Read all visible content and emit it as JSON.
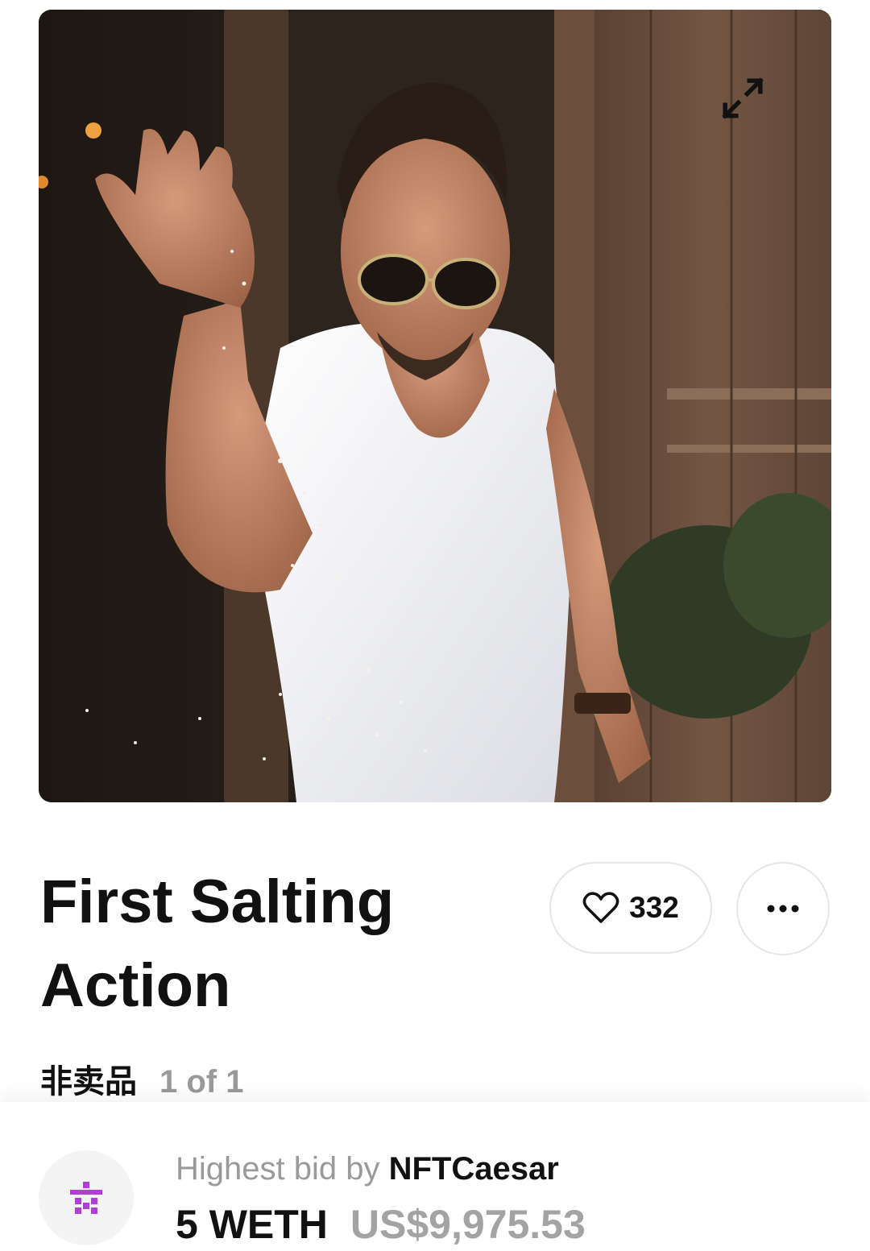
{
  "nft": {
    "title": "First Salting Action",
    "likes": "332",
    "sale_status": "非卖品",
    "edition": "1 of 1"
  },
  "bid": {
    "label": "Highest bid by",
    "bidder": "NFTCaesar",
    "amount": "5 WETH",
    "fiat": "US$9,975.53",
    "avatar_color": "#b03fd6"
  },
  "icons": {
    "expand": "expand-arrows-icon",
    "like": "heart-outline-icon",
    "more": "ellipsis-icon"
  }
}
